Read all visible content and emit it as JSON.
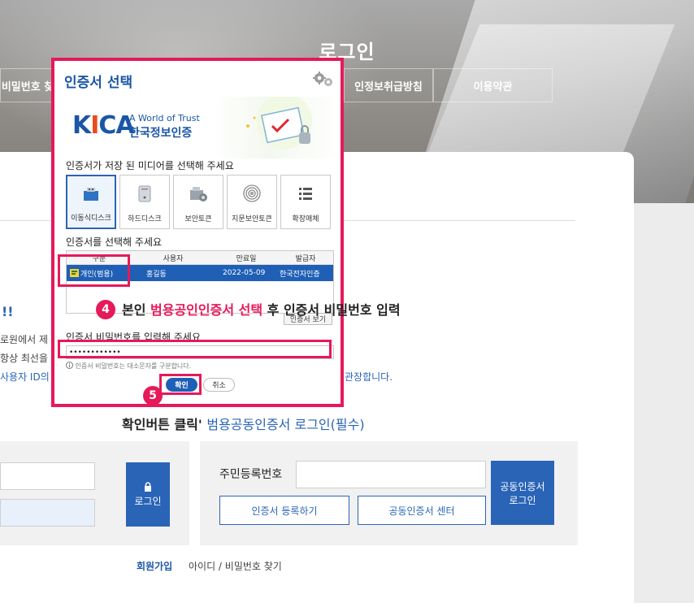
{
  "page": {
    "title": "로그인",
    "tabs": [
      "비밀번호 찾",
      "인정보취급방침",
      "이용약관"
    ]
  },
  "background": {
    "notice_mark": "!!",
    "line1": "로원에서 제",
    "line2": "항상 최선을",
    "line3": "사용자 ID의",
    "line_tail": "관장합니다."
  },
  "dialog": {
    "title": "인증서 선택",
    "settings_icon": "gears-icon",
    "brand": {
      "logo_text_left": "K",
      "logo_text_i": "I",
      "logo_text_right": "CA",
      "tagline": "A World of Trust",
      "name_ko": "한국정보인증"
    },
    "media_prompt": "인증서가 저장 된 미디어를 선택해 주세요",
    "media": [
      {
        "label": "이동식디스크",
        "icon": "usb-drive-icon",
        "selected": true
      },
      {
        "label": "하드디스크",
        "icon": "hard-disk-icon",
        "selected": false
      },
      {
        "label": "보안토큰",
        "icon": "security-token-icon",
        "selected": false
      },
      {
        "label": "지문보안토큰",
        "icon": "fingerprint-icon",
        "selected": false
      },
      {
        "label": "확장매체",
        "icon": "list-icon",
        "selected": false
      }
    ],
    "cert_prompt": "인증서를 선택해 주세요",
    "table": {
      "headers": [
        "구분",
        "사용자",
        "만료일",
        "발급자"
      ],
      "rows": [
        {
          "type": "개인(범용)",
          "user": "홍길동",
          "expiry": "2022-05-09",
          "issuer": "한국전자인증"
        }
      ]
    },
    "view_cert_label": "인증서 보기",
    "pw_prompt": "인증서 비밀번호를 입력해 주세요",
    "pw_value": "••••••••••••",
    "pw_note": "인증서 비밀번호는 대소문자를 구분합니다.",
    "ok_label": "확인",
    "cancel_label": "취소"
  },
  "annotations": {
    "step4_number": "4",
    "step4_text_a": "본인 ",
    "step4_text_hl": "범용공인인증서 선택",
    "step4_text_b": " 후 인증서 비밀번호 입력",
    "step5_number": "5",
    "click_text": "확인버튼 클릭",
    "click_text_blue": "범용공동인증서 로그인(필수)"
  },
  "login": {
    "left_button_label": "로그인",
    "left_button_icon": "lock-icon",
    "rrn_label": "주민등록번호",
    "register_cert_label": "인증서 등록하기",
    "cert_center_label": "공동인증서 센터",
    "cert_login_label_1": "공동인증서",
    "cert_login_label_2": "로그인"
  },
  "footer": {
    "signup_label": "회원가입",
    "find_label": "아이디 / 비밀번호 찾기"
  },
  "colors": {
    "accent_red": "#e6195a",
    "brand_blue": "#1b56a6",
    "button_blue": "#2a64b7"
  }
}
